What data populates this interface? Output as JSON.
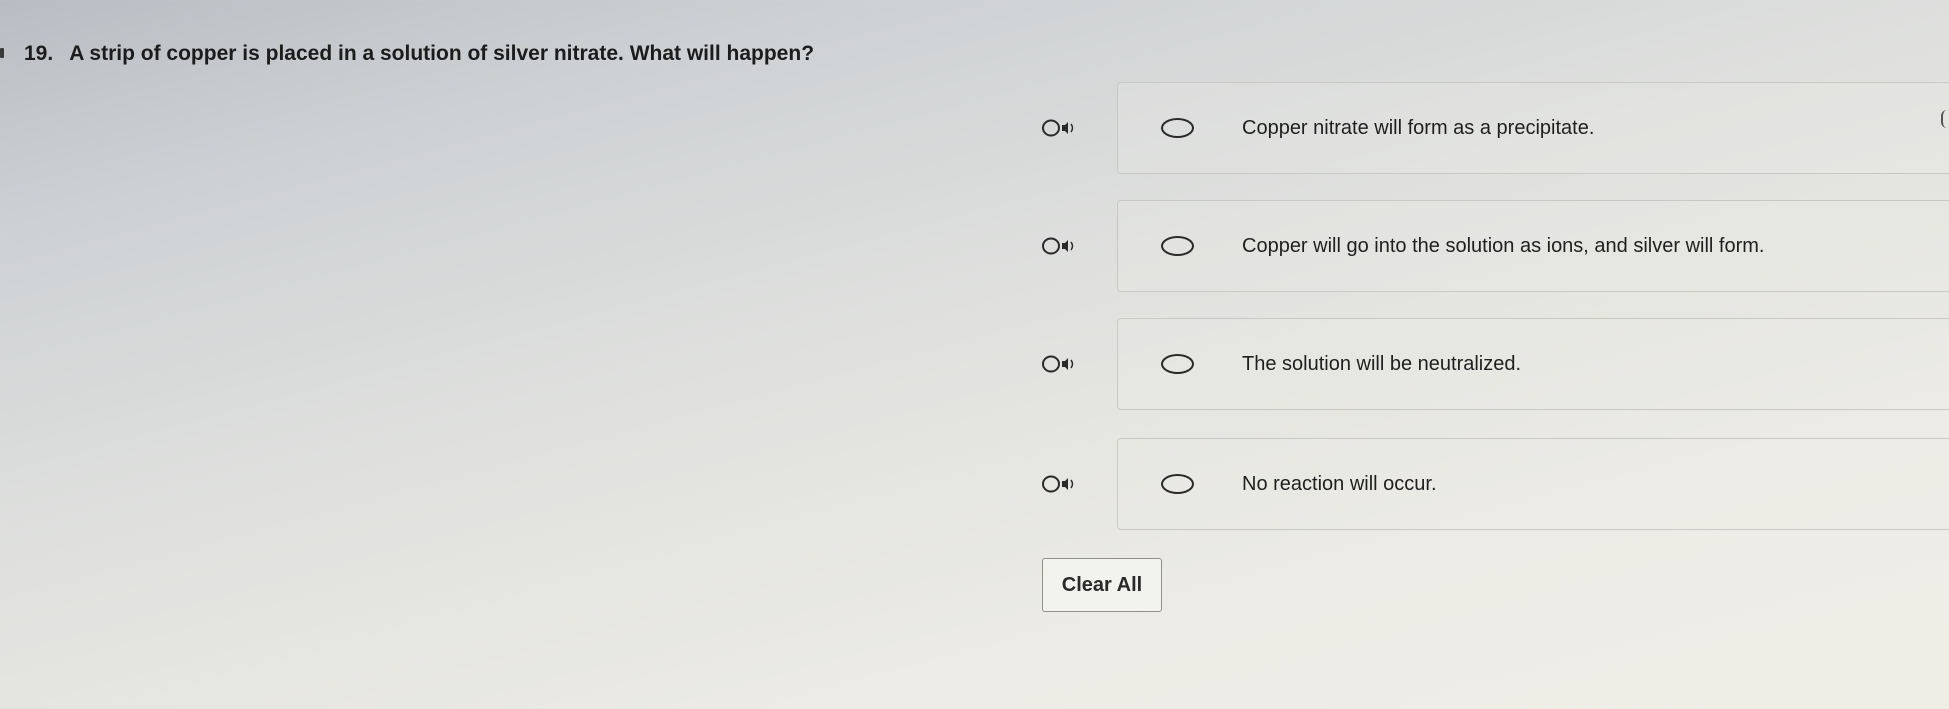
{
  "question": {
    "number": "19.",
    "text": "A strip of copper is placed in a solution of silver nitrate. What will happen?"
  },
  "choices": [
    {
      "text": "Copper nitrate will form as a precipitate.",
      "selected": false,
      "icon": "speaker-icon"
    },
    {
      "text": "Copper will go into the solution as ions, and silver will form.",
      "selected": false,
      "icon": "speaker-icon"
    },
    {
      "text": "The solution will be neutralized.",
      "selected": false,
      "icon": "speaker-icon"
    },
    {
      "text": "No reaction will occur.",
      "selected": false,
      "icon": "speaker-icon"
    }
  ],
  "actions": {
    "clear_all_label": "Clear All"
  }
}
